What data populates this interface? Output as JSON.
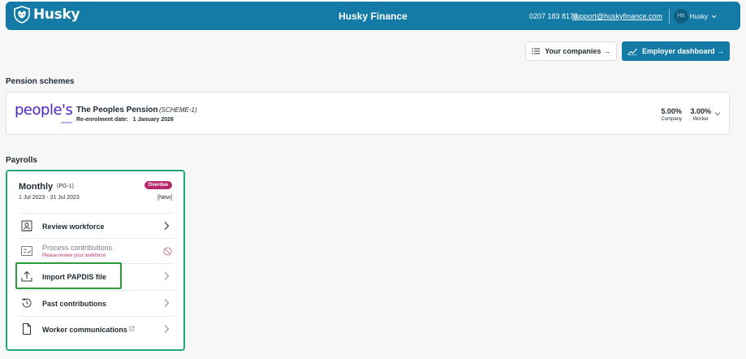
{
  "header": {
    "logo_text": "Husky",
    "app_title": "Husky Finance",
    "phone": "0207 183 8178",
    "email": "support@huskyfinance.com",
    "avatar_initials": "HS",
    "user_name": "Husky",
    "background_color": "#137ba6"
  },
  "actions": {
    "companies_label": "Your companies →",
    "employer_label": "Employer dashboard →"
  },
  "pension": {
    "section_title": "Pension schemes",
    "logo_text": "people's",
    "logo_subtext": "pension",
    "scheme_name": "The Peoples Pension",
    "scheme_code": "(SCHEME-1)",
    "reenrolment_label": "Re-enrolment date:",
    "reenrolment_date": "1 January 2026",
    "company_rate": "5.00%",
    "company_label": "Company",
    "worker_rate": "3.00%",
    "worker_label": "Worker"
  },
  "payrolls": {
    "section_title": "Payrolls",
    "card": {
      "title": "Monthly",
      "code": "(PG-1)",
      "dates": "1 Jul 2023 - 31 Jul 2023",
      "status_badge": "Overdue",
      "tag": "[New]",
      "status_color": "#b8296a",
      "border_color": "#1daa7c"
    },
    "items": [
      {
        "label": "Review workforce",
        "icon": "person-badge-icon"
      },
      {
        "label": "Process contributions",
        "sub": "Please review your workforce",
        "icon": "checklist-icon",
        "disabled": true
      },
      {
        "label": "Import PAPDIS file",
        "icon": "upload-icon"
      },
      {
        "label": "Past contributions",
        "icon": "history-icon"
      },
      {
        "label": "Worker communications",
        "icon": "document-icon",
        "external": true
      }
    ]
  }
}
